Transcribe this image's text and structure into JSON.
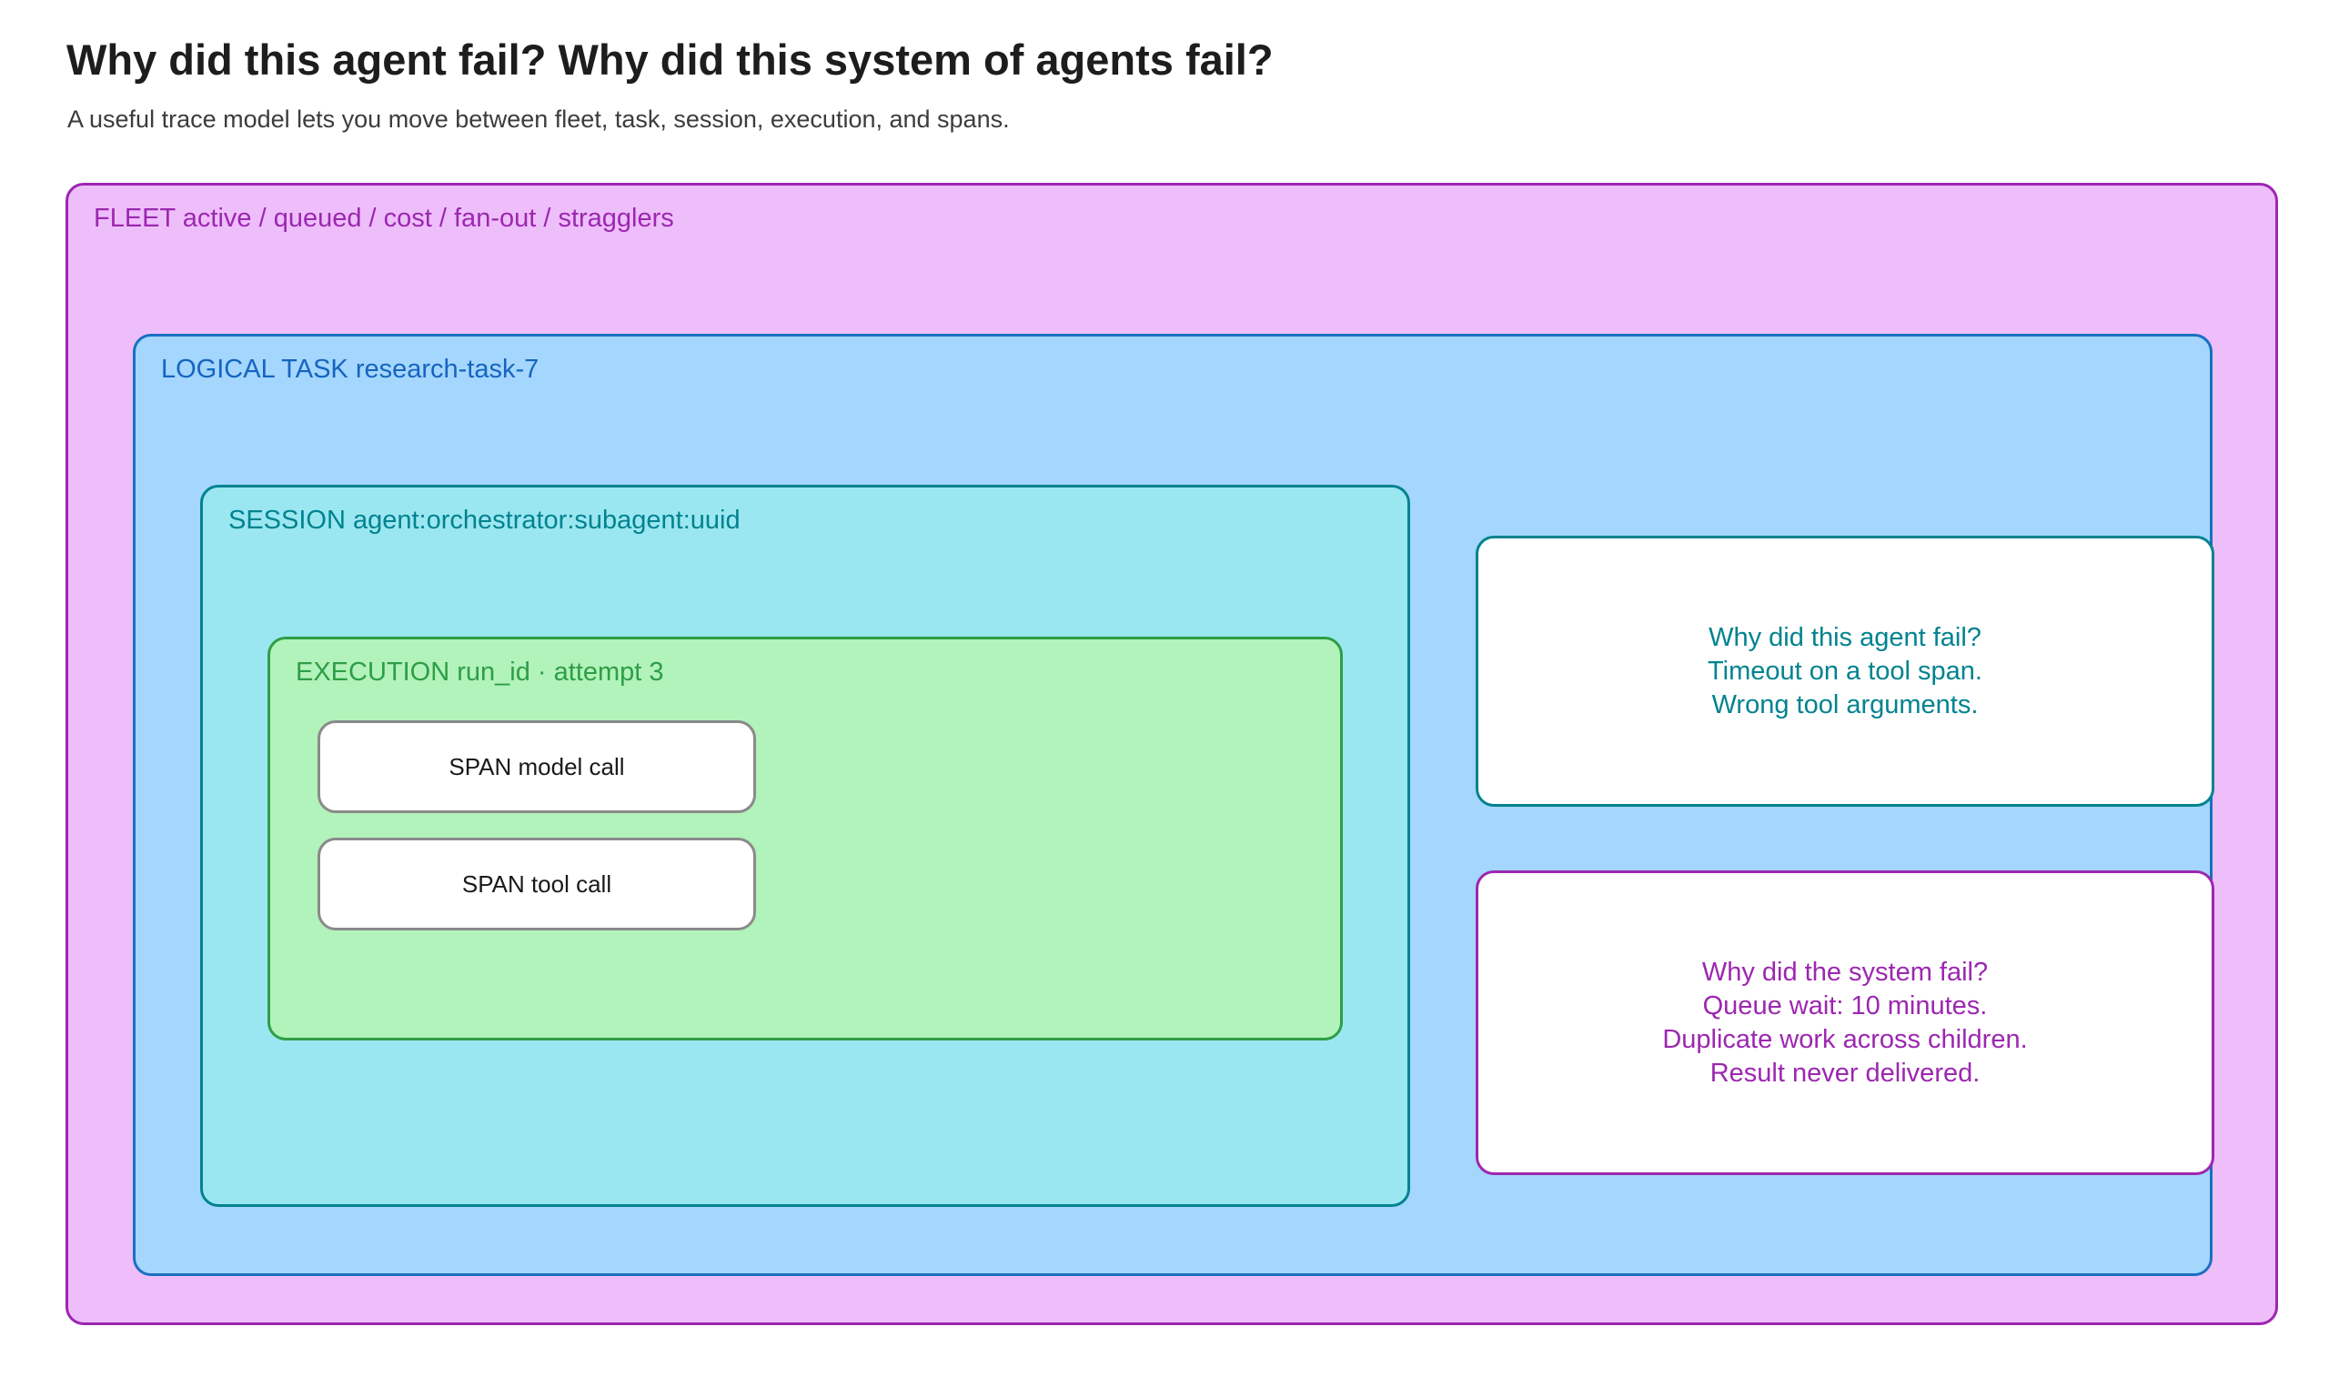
{
  "header": {
    "title": "Why did this agent fail? Why did this system of agents fail?",
    "subtitle": "A useful trace model lets you move between fleet, task, session, execution, and spans."
  },
  "diagram": {
    "fleet": {
      "label": "FLEET active / queued / cost / fan-out / stragglers"
    },
    "task": {
      "label": "LOGICAL TASK research-task-7"
    },
    "session": {
      "label": "SESSION agent:orchestrator:subagent:uuid"
    },
    "execution": {
      "label": "EXECUTION run_id · attempt 3"
    },
    "spans": [
      {
        "label": "SPAN model call"
      },
      {
        "label": "SPAN tool call"
      }
    ],
    "agent_failure_note": {
      "lines": [
        "Why did this agent fail?",
        "Timeout on a tool span.",
        "Wrong tool arguments."
      ]
    },
    "system_failure_note": {
      "lines": [
        "Why did the system fail?",
        "Queue wait: 10 minutes.",
        "Duplicate work across children.",
        "Result never delivered."
      ]
    }
  },
  "colors": {
    "fleet_fill": "#eebefb",
    "fleet_border": "#9c27b0",
    "task_fill": "#a5d6fd",
    "task_border": "#1a6fc2",
    "session_fill": "#9be7f1",
    "session_border": "#00838f",
    "execution_fill": "#b2f2bb",
    "execution_border": "#2e9e46"
  }
}
